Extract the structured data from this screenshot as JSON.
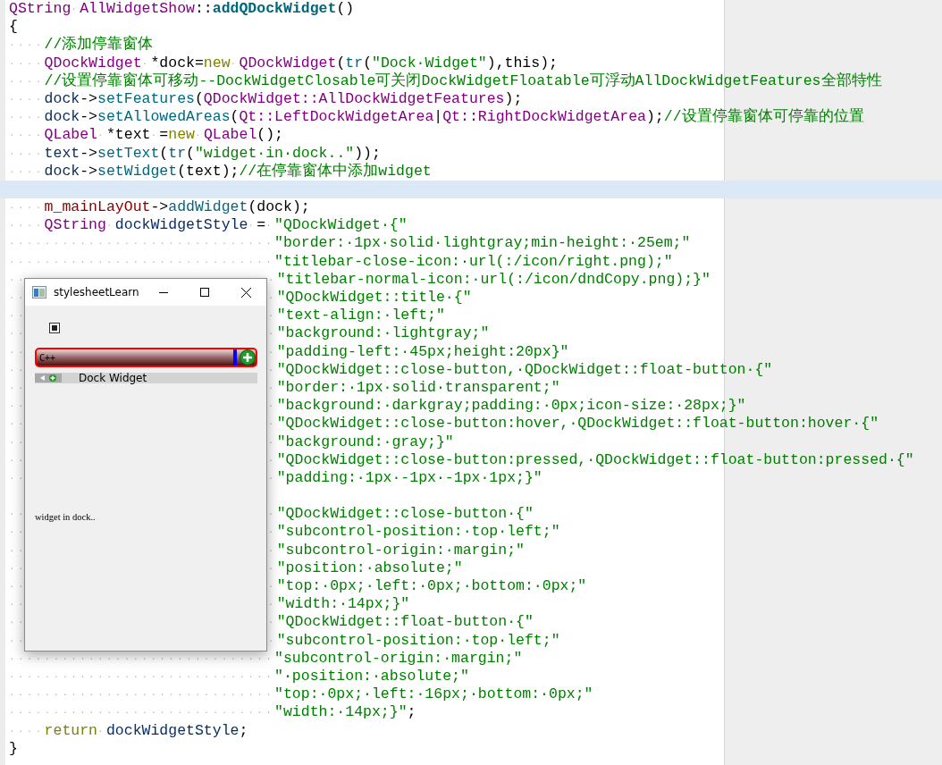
{
  "editor": {
    "lines": [
      {
        "current": false,
        "tokens": [
          {
            "kind": "type",
            "text": "QString"
          },
          {
            "kind": "ws",
            "text": "·"
          },
          {
            "kind": "type",
            "text": "AllWidgetShow"
          },
          {
            "kind": "plain",
            "text": "::"
          },
          {
            "kind": "fnbold",
            "text": "addQDockWidget"
          },
          {
            "kind": "plain",
            "text": "()"
          }
        ]
      },
      {
        "current": false,
        "tokens": [
          {
            "kind": "plain",
            "text": "{"
          }
        ]
      },
      {
        "current": false,
        "tokens": [
          {
            "kind": "ws",
            "text": "····"
          },
          {
            "kind": "cmt",
            "text": "//添加停靠窗体"
          }
        ]
      },
      {
        "current": false,
        "tokens": [
          {
            "kind": "ws",
            "text": "····"
          },
          {
            "kind": "type",
            "text": "QDockWidget"
          },
          {
            "kind": "ws",
            "text": "·"
          },
          {
            "kind": "plain",
            "text": "*dock="
          },
          {
            "kind": "kw",
            "text": "new"
          },
          {
            "kind": "ws",
            "text": "·"
          },
          {
            "kind": "type",
            "text": "QDockWidget"
          },
          {
            "kind": "plain",
            "text": "("
          },
          {
            "kind": "fn",
            "text": "tr"
          },
          {
            "kind": "plain",
            "text": "("
          },
          {
            "kind": "str",
            "text": "\"Dock·Widget\""
          },
          {
            "kind": "plain",
            "text": "),this);"
          }
        ]
      },
      {
        "current": false,
        "tokens": [
          {
            "kind": "ws",
            "text": "····"
          },
          {
            "kind": "cmt",
            "text": "//设置停靠窗体可移动--DockWidgetClosable可关闭DockWidgetFloatable可浮动AllDockWidgetFeatures全部特性"
          }
        ]
      },
      {
        "current": false,
        "tokens": [
          {
            "kind": "ws",
            "text": "····"
          },
          {
            "kind": "var",
            "text": "dock"
          },
          {
            "kind": "plain",
            "text": "->"
          },
          {
            "kind": "fn",
            "text": "setFeatures"
          },
          {
            "kind": "plain",
            "text": "("
          },
          {
            "kind": "type",
            "text": "QDockWidget::AllDockWidgetFeatures"
          },
          {
            "kind": "plain",
            "text": ");"
          }
        ]
      },
      {
        "current": false,
        "tokens": [
          {
            "kind": "ws",
            "text": "····"
          },
          {
            "kind": "var",
            "text": "dock"
          },
          {
            "kind": "plain",
            "text": "->"
          },
          {
            "kind": "fn",
            "text": "setAllowedAreas"
          },
          {
            "kind": "plain",
            "text": "("
          },
          {
            "kind": "type",
            "text": "Qt::LeftDockWidgetArea"
          },
          {
            "kind": "plain",
            "text": "|"
          },
          {
            "kind": "type",
            "text": "Qt::RightDockWidgetArea"
          },
          {
            "kind": "plain",
            "text": ");"
          },
          {
            "kind": "cmt",
            "text": "//设置停靠窗体可停靠的位置"
          }
        ]
      },
      {
        "current": false,
        "tokens": [
          {
            "kind": "ws",
            "text": "····"
          },
          {
            "kind": "type",
            "text": "QLabel"
          },
          {
            "kind": "ws",
            "text": "·"
          },
          {
            "kind": "plain",
            "text": "*text"
          },
          {
            "kind": "ws",
            "text": "·"
          },
          {
            "kind": "plain",
            "text": "="
          },
          {
            "kind": "kw",
            "text": "new"
          },
          {
            "kind": "ws",
            "text": "·"
          },
          {
            "kind": "type",
            "text": "QLabel"
          },
          {
            "kind": "plain",
            "text": "();"
          }
        ]
      },
      {
        "current": false,
        "tokens": [
          {
            "kind": "ws",
            "text": "····"
          },
          {
            "kind": "var",
            "text": "text"
          },
          {
            "kind": "plain",
            "text": "->"
          },
          {
            "kind": "fn",
            "text": "setText"
          },
          {
            "kind": "plain",
            "text": "("
          },
          {
            "kind": "fn",
            "text": "tr"
          },
          {
            "kind": "plain",
            "text": "("
          },
          {
            "kind": "str",
            "text": "\"widget·in·dock..\""
          },
          {
            "kind": "plain",
            "text": "));"
          }
        ]
      },
      {
        "current": false,
        "tokens": [
          {
            "kind": "ws",
            "text": "····"
          },
          {
            "kind": "var",
            "text": "dock"
          },
          {
            "kind": "plain",
            "text": "->"
          },
          {
            "kind": "fn",
            "text": "setWidget"
          },
          {
            "kind": "plain",
            "text": "(text);"
          },
          {
            "kind": "cmt",
            "text": "//在停靠窗体中添加widget"
          }
        ]
      },
      {
        "current": true
      },
      {
        "current": false,
        "tokens": [
          {
            "kind": "ws",
            "text": "····"
          },
          {
            "kind": "member",
            "text": "m_mainLayOut"
          },
          {
            "kind": "plain",
            "text": "->"
          },
          {
            "kind": "fn",
            "text": "addWidget"
          },
          {
            "kind": "plain",
            "text": "(dock);"
          }
        ]
      },
      {
        "current": false,
        "tokens": [
          {
            "kind": "ws",
            "text": "····"
          },
          {
            "kind": "type",
            "text": "QString"
          },
          {
            "kind": "ws",
            "text": "·"
          },
          {
            "kind": "var",
            "text": "dockWidgetStyle"
          },
          {
            "kind": "ws",
            "text": "·"
          },
          {
            "kind": "plain",
            "text": "="
          },
          {
            "kind": "ws",
            "text": "·"
          },
          {
            "kind": "str",
            "text": "\"QDockWidget·{\""
          }
        ]
      },
      {
        "current": false,
        "tokens": [
          {
            "kind": "ws",
            "text": "······························"
          },
          {
            "kind": "str",
            "text": "\"border:·1px·solid·lightgray;min-height:·25em;\""
          }
        ]
      },
      {
        "current": false,
        "tokens": [
          {
            "kind": "ws",
            "text": "······························"
          },
          {
            "kind": "str",
            "text": "\"titlebar-close-icon:·url(:/icon/right.png);\""
          }
        ]
      },
      {
        "current": false,
        "covered": true,
        "tokens": [
          {
            "kind": "ws",
            "text": "··"
          },
          {
            "kind": "ws",
            "text": "·"
          },
          {
            "kind": "str",
            "text": "\"titlebar-normal-icon:·url(:/icon/dndCopy.png);}\""
          }
        ]
      },
      {
        "current": false,
        "covered": true,
        "tokens": [
          {
            "kind": "ws",
            "text": "··"
          },
          {
            "kind": "ws",
            "text": "·"
          },
          {
            "kind": "str",
            "text": "\"QDockWidget::title·{\""
          }
        ]
      },
      {
        "current": false,
        "covered": true,
        "tokens": [
          {
            "kind": "ws",
            "text": "··"
          },
          {
            "kind": "ws",
            "text": "·"
          },
          {
            "kind": "str",
            "text": "\"text-align:·left;\""
          }
        ]
      },
      {
        "current": false,
        "covered": true,
        "tokens": [
          {
            "kind": "ws",
            "text": "··"
          },
          {
            "kind": "ws",
            "text": "·"
          },
          {
            "kind": "str",
            "text": "\"background:·lightgray;\""
          }
        ]
      },
      {
        "current": false,
        "covered": true,
        "tokens": [
          {
            "kind": "ws",
            "text": "··"
          },
          {
            "kind": "ws",
            "text": "·"
          },
          {
            "kind": "str",
            "text": "\"padding-left:·45px;height:20px}\""
          }
        ]
      },
      {
        "current": false,
        "covered": true,
        "tokens": [
          {
            "kind": "ws",
            "text": "··"
          },
          {
            "kind": "ws",
            "text": "·"
          },
          {
            "kind": "str",
            "text": "\"QDockWidget::close-button,·QDockWidget::float-button·{\""
          }
        ]
      },
      {
        "current": false,
        "covered": true,
        "tokens": [
          {
            "kind": "ws",
            "text": "··"
          },
          {
            "kind": "ws",
            "text": "·"
          },
          {
            "kind": "str",
            "text": "\"border:·1px·solid·transparent;\""
          }
        ]
      },
      {
        "current": false,
        "covered": true,
        "tokens": [
          {
            "kind": "ws",
            "text": "··"
          },
          {
            "kind": "ws",
            "text": "·"
          },
          {
            "kind": "str",
            "text": "\"background:·darkgray;padding:·0px;icon-size:·28px;}\""
          }
        ]
      },
      {
        "current": false,
        "covered": true,
        "tokens": [
          {
            "kind": "ws",
            "text": "··"
          },
          {
            "kind": "ws",
            "text": "·"
          },
          {
            "kind": "str",
            "text": "\"QDockWidget::close-button:hover,·QDockWidget::float-button:hover·{\""
          }
        ]
      },
      {
        "current": false,
        "covered": true,
        "tokens": [
          {
            "kind": "ws",
            "text": "··"
          },
          {
            "kind": "ws",
            "text": "·"
          },
          {
            "kind": "str",
            "text": "\"background:·gray;}\""
          }
        ]
      },
      {
        "current": false,
        "covered": true,
        "tokens": [
          {
            "kind": "ws",
            "text": "··"
          },
          {
            "kind": "ws",
            "text": "·"
          },
          {
            "kind": "str",
            "text": "\"QDockWidget::close-button:pressed,·QDockWidget::float-button:pressed·{\""
          }
        ]
      },
      {
        "current": false,
        "covered": true,
        "tokens": [
          {
            "kind": "ws",
            "text": "··"
          },
          {
            "kind": "ws",
            "text": "·"
          },
          {
            "kind": "str",
            "text": "\"padding:·1px·-1px·-1px·1px;}\""
          }
        ]
      },
      {
        "current": false
      },
      {
        "current": false,
        "covered": true,
        "tokens": [
          {
            "kind": "ws",
            "text": "··"
          },
          {
            "kind": "ws",
            "text": "·"
          },
          {
            "kind": "str",
            "text": "\"QDockWidget::close-button·{\""
          }
        ]
      },
      {
        "current": false,
        "covered": true,
        "tokens": [
          {
            "kind": "ws",
            "text": "··"
          },
          {
            "kind": "ws",
            "text": "·"
          },
          {
            "kind": "str",
            "text": "\"subcontrol-position:·top·left;\""
          }
        ]
      },
      {
        "current": false,
        "covered": true,
        "tokens": [
          {
            "kind": "ws",
            "text": "··"
          },
          {
            "kind": "ws",
            "text": "·"
          },
          {
            "kind": "str",
            "text": "\"subcontrol-origin:·margin;\""
          }
        ]
      },
      {
        "current": false,
        "covered": true,
        "tokens": [
          {
            "kind": "ws",
            "text": "··"
          },
          {
            "kind": "ws",
            "text": "·"
          },
          {
            "kind": "str",
            "text": "\"position:·absolute;\""
          }
        ]
      },
      {
        "current": false,
        "covered": true,
        "tokens": [
          {
            "kind": "ws",
            "text": "··"
          },
          {
            "kind": "ws",
            "text": "·"
          },
          {
            "kind": "str",
            "text": "\"top:·0px;·left:·0px;·bottom:·0px;\""
          }
        ]
      },
      {
        "current": false,
        "covered": true,
        "tokens": [
          {
            "kind": "ws",
            "text": "··"
          },
          {
            "kind": "ws",
            "text": "·"
          },
          {
            "kind": "str",
            "text": "\"width:·14px;}\""
          }
        ]
      },
      {
        "current": false,
        "covered": true,
        "tokens": [
          {
            "kind": "ws",
            "text": "··"
          },
          {
            "kind": "ws",
            "text": "·"
          },
          {
            "kind": "str",
            "text": "\"QDockWidget::float-button·{\""
          }
        ]
      },
      {
        "current": false,
        "covered": true,
        "tokens": [
          {
            "kind": "ws",
            "text": "··"
          },
          {
            "kind": "ws",
            "text": "·"
          },
          {
            "kind": "str",
            "text": "\"subcontrol-position:·top·left;\""
          }
        ]
      },
      {
        "current": false,
        "tokens": [
          {
            "kind": "ws",
            "text": "······························"
          },
          {
            "kind": "str",
            "text": "\"subcontrol-origin:·margin;\""
          }
        ]
      },
      {
        "current": false,
        "tokens": [
          {
            "kind": "ws",
            "text": "······························"
          },
          {
            "kind": "str",
            "text": "\"·position:·absolute;\""
          }
        ]
      },
      {
        "current": false,
        "tokens": [
          {
            "kind": "ws",
            "text": "······························"
          },
          {
            "kind": "str",
            "text": "\"top:·0px;·left:·16px;·bottom:·0px;\""
          }
        ]
      },
      {
        "current": false,
        "tokens": [
          {
            "kind": "ws",
            "text": "······························"
          },
          {
            "kind": "str",
            "text": "\"width:·14px;}\""
          },
          {
            "kind": "plain",
            "text": ";"
          }
        ]
      },
      {
        "current": false,
        "tokens": [
          {
            "kind": "ws",
            "text": "····"
          },
          {
            "kind": "kw",
            "text": "return"
          },
          {
            "kind": "ws",
            "text": "·"
          },
          {
            "kind": "var",
            "text": "dockWidgetStyle"
          },
          {
            "kind": "plain",
            "text": ";"
          }
        ]
      },
      {
        "current": false,
        "tokens": [
          {
            "kind": "plain",
            "text": "}"
          }
        ]
      }
    ]
  },
  "window": {
    "title": "stylesheetLearn",
    "checkbox": {
      "checked": true
    },
    "combo": {
      "text": "C++"
    },
    "dock": {
      "title": "Dock Widget",
      "content": "widget in dock.."
    }
  }
}
